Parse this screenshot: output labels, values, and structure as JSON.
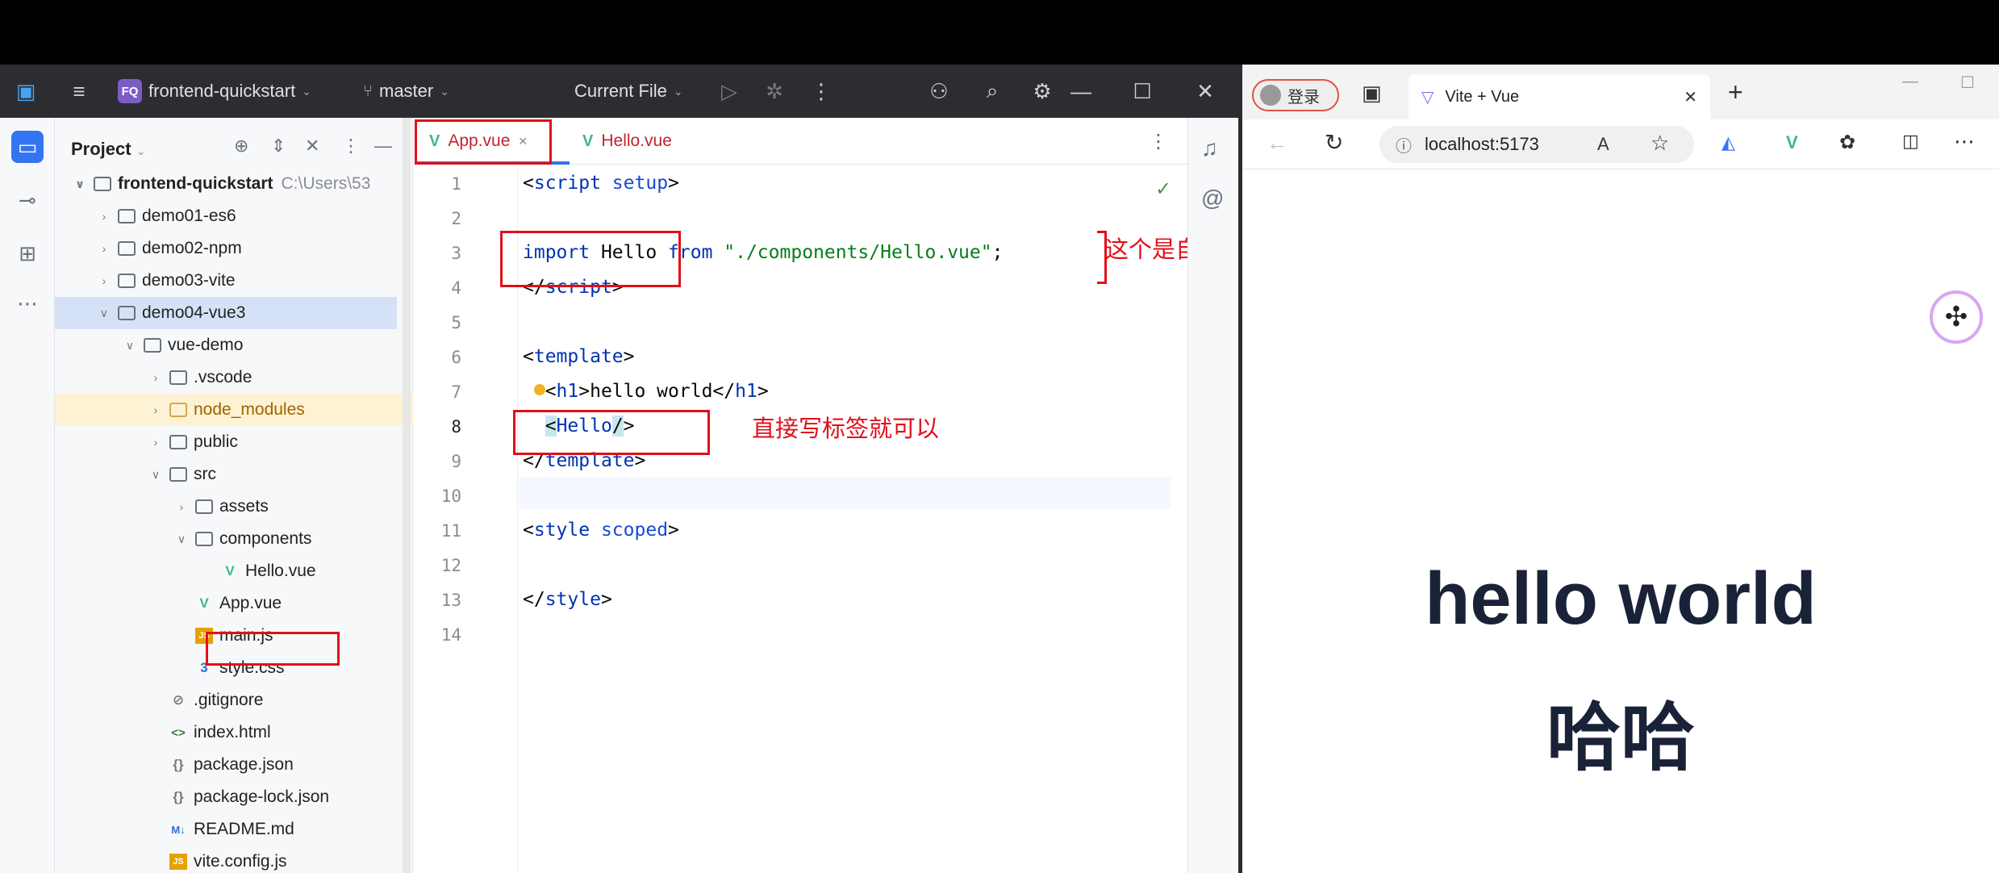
{
  "ide": {
    "project_badge": "FQ",
    "project_name": "frontend-quickstart",
    "branch": "master",
    "run_config": "Current File",
    "panel_title": "Project",
    "tree": [
      {
        "label": "frontend-quickstart",
        "path": "C:\\Users\\53"
      },
      {
        "label": "demo01-es6"
      },
      {
        "label": "demo02-npm"
      },
      {
        "label": "demo03-vite"
      },
      {
        "label": "demo04-vue3"
      },
      {
        "label": "vue-demo"
      },
      {
        "label": ".vscode"
      },
      {
        "label": "node_modules"
      },
      {
        "label": "public"
      },
      {
        "label": "src"
      },
      {
        "label": "assets"
      },
      {
        "label": "components"
      },
      {
        "label": "Hello.vue"
      },
      {
        "label": "App.vue"
      },
      {
        "label": "main.js"
      },
      {
        "label": "style.css"
      },
      {
        "label": ".gitignore"
      },
      {
        "label": "index.html"
      },
      {
        "label": "package.json"
      },
      {
        "label": "package-lock.json"
      },
      {
        "label": "README.md"
      },
      {
        "label": "vite.config.js"
      }
    ],
    "icon_labels": {
      "js": "JS",
      "md": "M↓",
      "html": "<>",
      "json": "{}",
      "css": "3"
    },
    "tabs": [
      "App.vue",
      "Hello.vue"
    ],
    "line_numbers": [
      "1",
      "2",
      "3",
      "4",
      "5",
      "6",
      "7",
      "8",
      "9",
      "10",
      "11",
      "12",
      "13",
      "14"
    ],
    "code": {
      "l1_open": "<",
      "l1_tag": "script",
      "l1_attr": " setup",
      "l1_close": ">",
      "l3_import": "import",
      "l3_name": " Hello ",
      "l3_from": "from",
      "l3_str": " \"./components/Hello.vue\"",
      "l3_end": ";",
      "l4_open": "</",
      "l4_tag": "script",
      "l4_close": ">",
      "l6_open": "<",
      "l6_tag": "template",
      "l6_close": ">",
      "l7_pre": "  <",
      "l7_tag": "h1",
      "l7_mid": ">hello world</",
      "l7_tag2": "h1",
      "l7_end": ">",
      "l8_pre": "  ",
      "l8_lt": "<",
      "l8_tag": "Hello",
      "l8_slash": "/",
      "l8_gt": ">",
      "l9_open": "</",
      "l9_tag": "template",
      "l9_close": ">",
      "l11_open": "<",
      "l11_tag": "style",
      "l11_attr": " scoped",
      "l11_close": ">",
      "l13_open": "</",
      "l13_tag": "style",
      "l13_close": ">"
    },
    "notes": {
      "auto_import": "这个是自动导入的",
      "write_tag": "直接写标签就可以"
    }
  },
  "browser": {
    "login": "登录",
    "tab_title": "Vite + Vue",
    "url": "localhost:5173",
    "heading1": "hello world",
    "heading2": "哈哈"
  },
  "colors": {
    "accent": "#3574f0",
    "vue_green": "#41b883",
    "annotation_red": "#e0101a"
  }
}
